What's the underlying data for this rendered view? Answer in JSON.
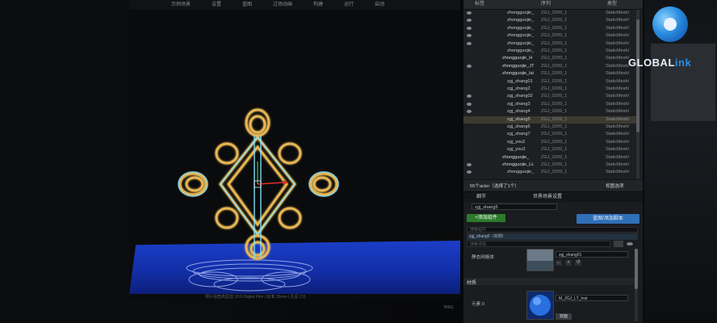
{
  "viewport": {
    "menu": [
      "示例场景",
      "设置",
      "蓝图",
      "过场动画",
      "构建",
      "运行",
      "启动"
    ],
    "status_text": "预片视角类型选 16:9 Digital Film | 标准   35mm | 孔径   2.8",
    "corner_text": "B991"
  },
  "outliner": {
    "col_label": "标签",
    "col_hierarchy": "序列",
    "col_type": "类型",
    "rows": [
      {
        "name": "zhongguojie_",
        "folder": "ZGJ_0209_1",
        "type": "StaticMesh/"
      },
      {
        "name": "zhongguojie_",
        "folder": "ZGJ_0209_1",
        "type": "StaticMesh/"
      },
      {
        "name": "zhongguojie_",
        "folder": "ZGJ_0209_1",
        "type": "StaticMesh/"
      },
      {
        "name": "zhongguojie_",
        "folder": "ZGJ_0209_1",
        "type": "StaticMesh/"
      },
      {
        "name": "zhongguojie_",
        "folder": "ZGJ_0209_1",
        "type": "StaticMesh/"
      },
      {
        "name": "zhongguojie_",
        "folder": "ZGJ_0209_1",
        "type": "StaticMesh/"
      },
      {
        "name": "zhongguojie_H",
        "folder": "ZGJ_0209_1",
        "type": "StaticMesh/"
      },
      {
        "name": "zhongguojie_JT",
        "folder": "ZGJ_0209_1",
        "type": "StaticMesh/"
      },
      {
        "name": "zhongguojie_lai",
        "folder": "ZGJ_0209_1",
        "type": "StaticMesh/"
      },
      {
        "name": "zgj_shang01",
        "folder": "ZGJ_0209_1",
        "type": "StaticMesh/"
      },
      {
        "name": "zgj_shang2",
        "folder": "ZGJ_0209_1",
        "type": "StaticMesh/"
      },
      {
        "name": "zgj_shang02",
        "folder": "ZGJ_0209_1",
        "type": "StaticMesh/"
      },
      {
        "name": "zgj_shang3",
        "folder": "ZGJ_0209_1",
        "type": "StaticMesh/"
      },
      {
        "name": "zgj_shang4",
        "folder": "ZGJ_0209_1",
        "type": "StaticMesh/"
      },
      {
        "name": "zgj_shang5",
        "folder": "ZGJ_0209_1",
        "type": "StaticMesh/"
      },
      {
        "name": "zgj_shang6",
        "folder": "ZGJ_0209_1",
        "type": "StaticMesh/"
      },
      {
        "name": "zgj_shang7",
        "folder": "ZGJ_0209_1",
        "type": "StaticMesh/"
      },
      {
        "name": "zgj_you2",
        "folder": "ZGJ_0209_1",
        "type": "StaticMesh/"
      },
      {
        "name": "zgj_you3",
        "folder": "ZGJ_0209_1",
        "type": "StaticMesh/"
      },
      {
        "name": "zhongguojie_",
        "folder": "ZGJ_0209_1",
        "type": "StaticMesh/"
      },
      {
        "name": "zhongguojie_LL",
        "folder": "ZGJ_0209_1",
        "type": "StaticMesh/"
      },
      {
        "name": "zhongguojie_",
        "folder": "ZGJ_0209_1",
        "type": "StaticMesh/"
      }
    ],
    "count_text": "55个actor（选择了1个）",
    "view_options": "视图选项"
  },
  "details": {
    "tab_details": "细节",
    "tab_world": "世界场景设置",
    "actor_name": "zgj_shang5",
    "add_component": "+添加组件",
    "blueprint_button": "蓝图/添加脚本",
    "search_components": "搜索组件",
    "component_row": "zgj_shang5（实例）",
    "search_details": "搜索详情",
    "static_mesh_label": "静态网格体",
    "static_mesh_value": "zgj_shang01",
    "materials_section": "材质",
    "element_label": "元素 0",
    "material_value": "M_ZGJ_LT_Inst",
    "dual_label": "双面"
  },
  "logo": {
    "text_a": "GLOBAL",
    "text_b": "ink"
  }
}
